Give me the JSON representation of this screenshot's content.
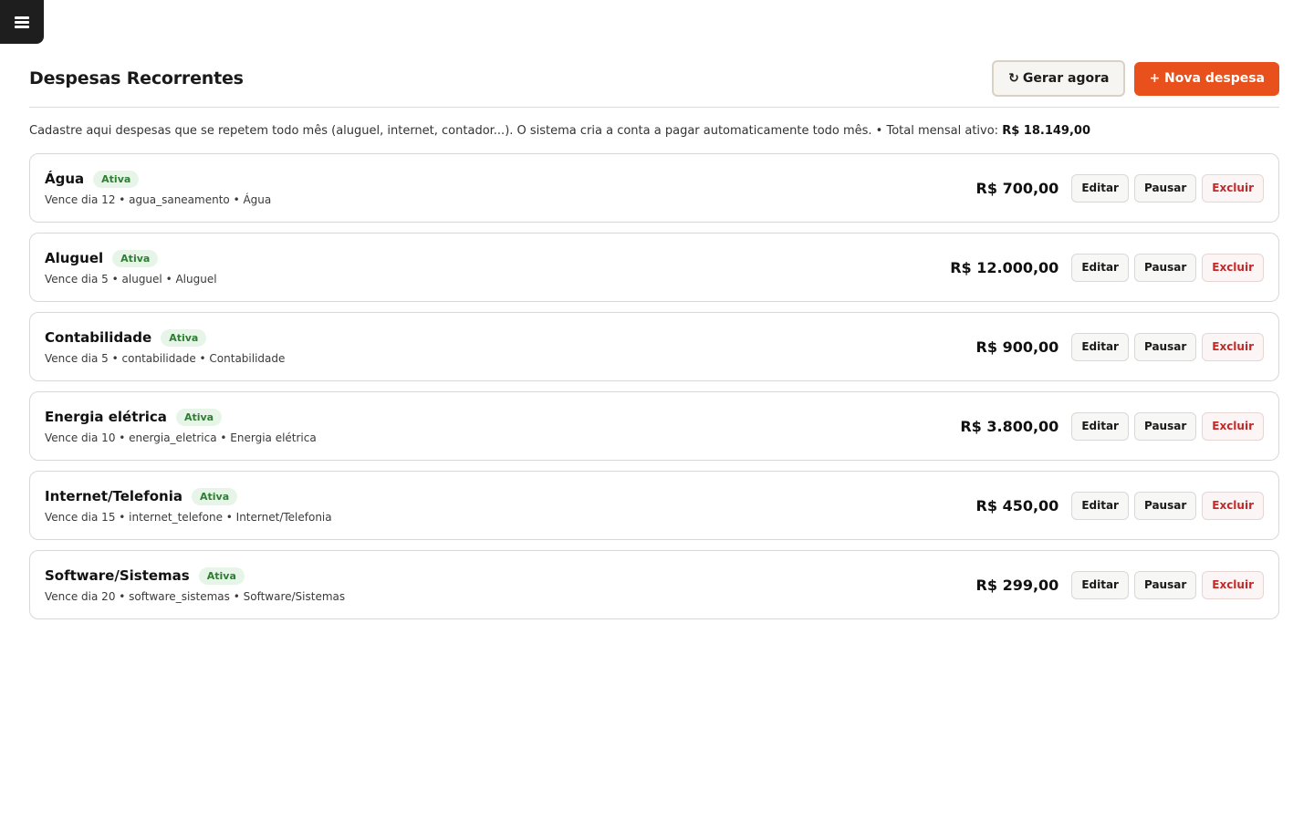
{
  "menu": {
    "icon": "hamburger-icon"
  },
  "header": {
    "title": "Despesas Recorrentes",
    "generate_icon": "↻",
    "generate_label": "Gerar agora",
    "new_label": "+ Nova despesa"
  },
  "subtitle": {
    "text": "Cadastre aqui despesas que se repetem todo mês (aluguel, internet, contador...). O sistema cria a conta a pagar automaticamente todo mês. • Total mensal ativo:",
    "total": "R$ 18.149,00"
  },
  "actions": {
    "edit": "Editar",
    "pause": "Pausar",
    "delete": "Excluir"
  },
  "colors": {
    "accent": "#e8501c",
    "status_active": "#2e7d32",
    "danger": "#c62828"
  },
  "expenses": [
    {
      "name": "Água",
      "status": "Ativa",
      "meta": "Vence dia 12 • agua_saneamento • Água",
      "amount": "R$ 700,00"
    },
    {
      "name": "Aluguel",
      "status": "Ativa",
      "meta": "Vence dia 5 • aluguel • Aluguel",
      "amount": "R$ 12.000,00"
    },
    {
      "name": "Contabilidade",
      "status": "Ativa",
      "meta": "Vence dia 5 • contabilidade • Contabilidade",
      "amount": "R$ 900,00"
    },
    {
      "name": "Energia elétrica",
      "status": "Ativa",
      "meta": "Vence dia 10 • energia_eletrica • Energia elétrica",
      "amount": "R$ 3.800,00"
    },
    {
      "name": "Internet/Telefonia",
      "status": "Ativa",
      "meta": "Vence dia 15 • internet_telefone • Internet/Telefonia",
      "amount": "R$ 450,00"
    },
    {
      "name": "Software/Sistemas",
      "status": "Ativa",
      "meta": "Vence dia 20 • software_sistemas • Software/Sistemas",
      "amount": "R$ 299,00"
    }
  ]
}
